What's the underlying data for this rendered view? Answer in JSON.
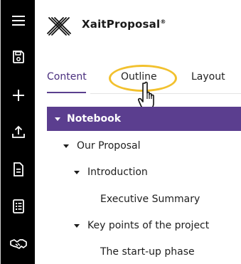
{
  "brand": {
    "name": "XaitProposal",
    "trademark": "®"
  },
  "tabs": [
    {
      "label": "Content",
      "active": true
    },
    {
      "label": "Outline",
      "active": false
    },
    {
      "label": "Layout",
      "active": false
    }
  ],
  "outline": [
    {
      "label": "Notebook",
      "level": 0,
      "expanded": true
    },
    {
      "label": "Our Proposal",
      "level": 1,
      "expanded": true
    },
    {
      "label": "Introduction",
      "level": 2,
      "expanded": true
    },
    {
      "label": "Executive Summary",
      "level": 3
    },
    {
      "label": "Key points of the project",
      "level": 2,
      "expanded": true
    },
    {
      "label": "The start-up phase",
      "level": 3
    }
  ],
  "sidebar_icons": [
    "menu-icon",
    "save-icon",
    "add-icon",
    "upload-icon",
    "document-icon",
    "checklist-icon",
    "handshake-icon"
  ],
  "colors": {
    "accent": "#5b3e8f",
    "highlight": "#f2c12e",
    "rail": "#000000"
  }
}
